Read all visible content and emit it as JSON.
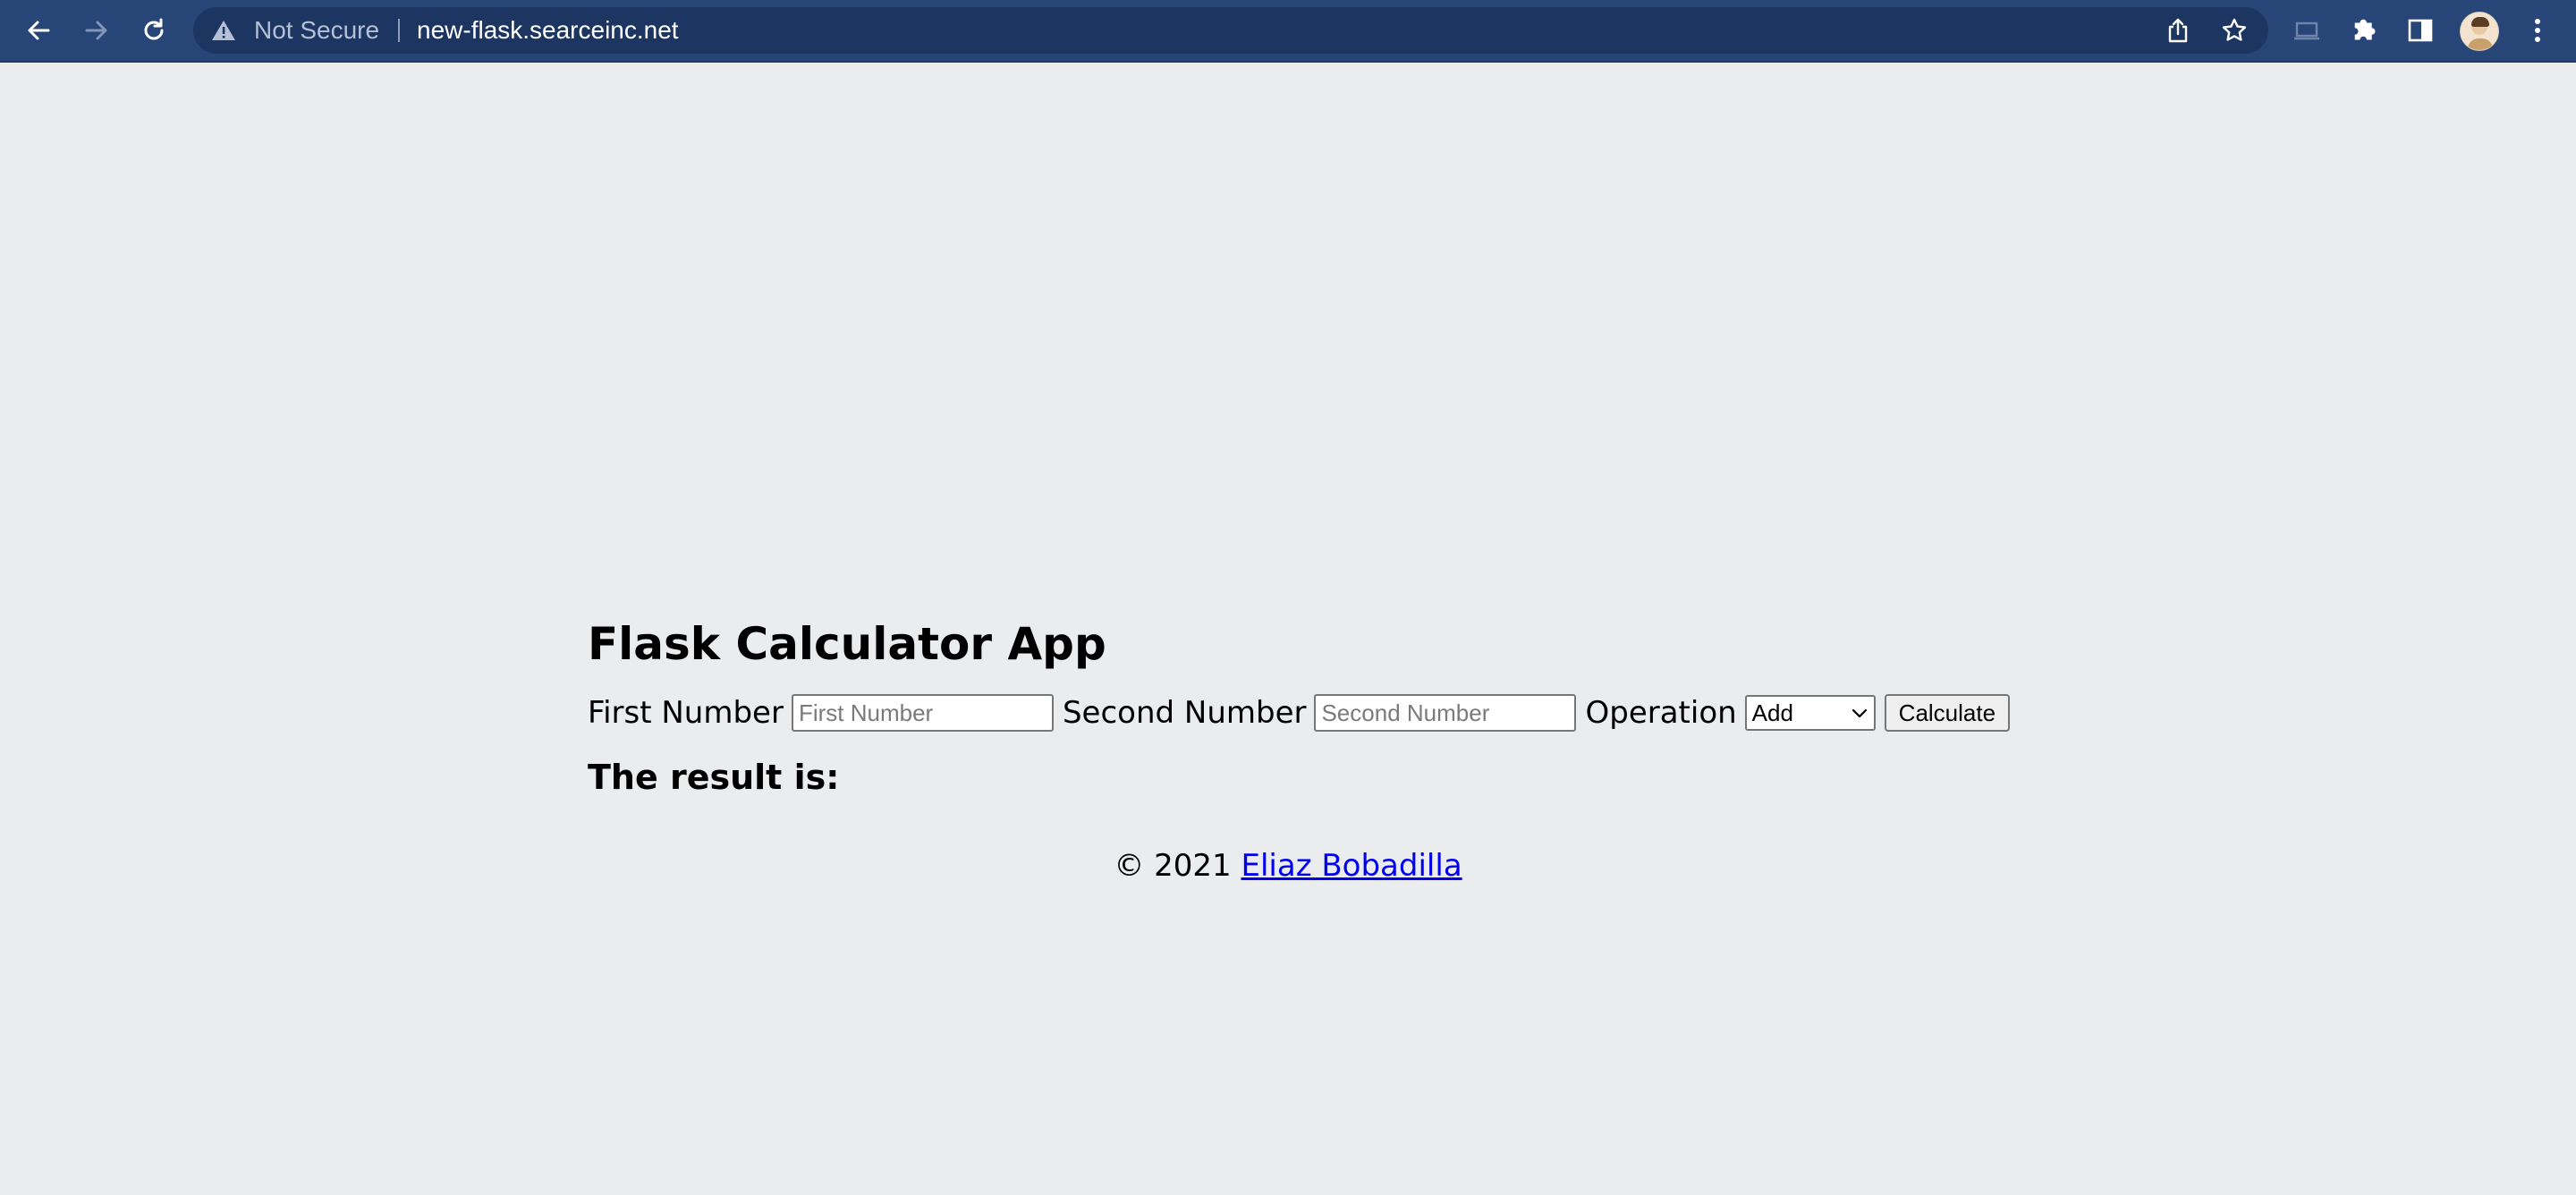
{
  "browser": {
    "security_label": "Not Secure",
    "url": "new-flask.searceinc.net",
    "icons": [
      "back-arrow-icon",
      "forward-arrow-icon",
      "reload-icon",
      "warning-icon",
      "share-icon",
      "star-icon",
      "cast-icon",
      "extensions-icon",
      "side-panel-icon",
      "avatar",
      "more-menu-icon"
    ]
  },
  "page": {
    "title": "Flask Calculator App",
    "first_number": {
      "label": "First Number",
      "placeholder": "First Number",
      "value": ""
    },
    "second_number": {
      "label": "Second Number",
      "placeholder": "Second Number",
      "value": ""
    },
    "operation": {
      "label": "Operation",
      "selected": "Add"
    },
    "calculate_label": "Calculate",
    "result_label": "The result is:",
    "footer": {
      "copyright": "© 2021",
      "author_link": "Eliaz Bobadilla"
    }
  },
  "colors": {
    "toolbar": "#274677",
    "omnibox": "#1d3561",
    "page_background": "#ebecee",
    "link": "#0000ee"
  }
}
